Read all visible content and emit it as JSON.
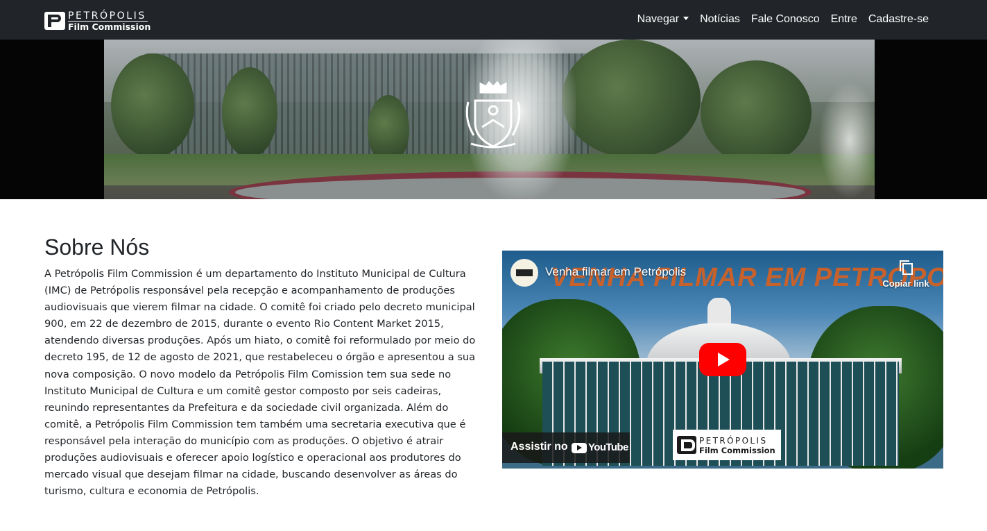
{
  "brand": {
    "top_text": "PETRÓPOLIS",
    "bottom_text": "Film Commission"
  },
  "nav": {
    "items": [
      {
        "label": "Navegar",
        "dropdown": true
      },
      {
        "label": "Notícias"
      },
      {
        "label": "Fale Conosco"
      },
      {
        "label": "Entre"
      },
      {
        "label": "Cadastre-se"
      }
    ]
  },
  "colors": {
    "navbar_bg": "#212529",
    "text": "#212529",
    "youtube_red": "#ff0000",
    "headline_orange": "#d9601f"
  },
  "about": {
    "title": "Sobre Nós",
    "body": "A Petrópolis Film Commission é um departamento do Instituto Municipal de Cultura (IMC) de Petrópolis responsável pela recepção e acompanhamento de produções audiovisuais que vierem filmar na cidade. O comitê foi criado pelo decreto municipal 900, em 22 de dezembro de 2015, durante o evento Rio Content Market 2015, atendendo diversas produções. Após um hiato, o comitê foi reformulado por meio do decreto 195, de 12 de agosto de 2021, que restabeleceu o órgão e apresentou a sua nova composição. O novo modelo da Petrópolis Film Comission tem sua sede no Instituto Municipal de Cultura e um comitê gestor composto por seis cadeiras, reunindo representantes da Prefeitura e da sociedade civil organizada. Além do comitê, a Petrópolis Film Commission tem também uma secretaria executiva que é responsável pela interação do município com as produções. O objetivo é atrair produções audiovisuais e oferecer apoio logístico e operacional aos produtores do mercado visual que desejam filmar na cidade, buscando desenvolver as áreas do turismo, cultura e economia de Petrópolis."
  },
  "video": {
    "title": "Venha filmar em Petrópolis",
    "headline": "VENHA FILMAR EM PETRÓPOLIS",
    "copy_link_label": "Copiar link",
    "watch_on_label": "Assistir no",
    "youtube_word": "YouTube",
    "logo_top": "PETRÓPOLIS",
    "logo_bottom": "Film Commission"
  },
  "icons": {
    "brand": "petropolis-logo-icon",
    "dropdown": "caret-down-icon",
    "crest": "city-crest-icon",
    "copy": "copy-icon",
    "play": "play-icon",
    "youtube": "youtube-icon"
  }
}
